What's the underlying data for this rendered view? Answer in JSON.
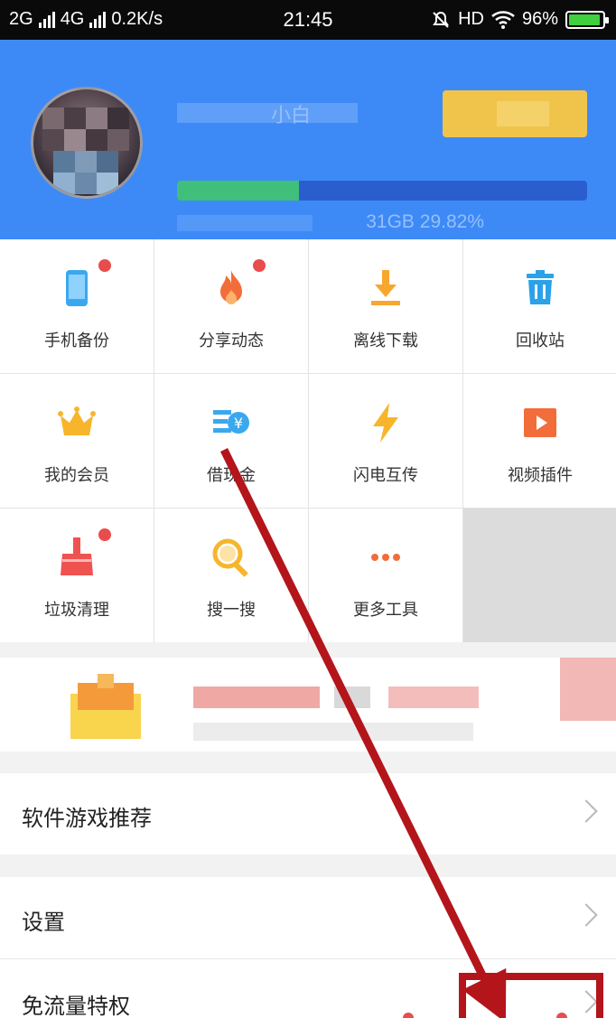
{
  "status_bar": {
    "network_1": "2G",
    "network_2": "4G",
    "speed": "0.2K/s",
    "time": "21:45",
    "hd": "HD",
    "battery": "96%"
  },
  "profile": {
    "username_partial": "小白",
    "storage_text": "31GB 29.82%",
    "storage_used_fraction": 0.2982
  },
  "tools": [
    {
      "label": "手机备份",
      "icon": "phone-backup-icon",
      "badge": true
    },
    {
      "label": "分享动态",
      "icon": "flame-icon",
      "badge": true
    },
    {
      "label": "离线下载",
      "icon": "download-icon",
      "badge": false
    },
    {
      "label": "回收站",
      "icon": "trash-icon",
      "badge": false
    },
    {
      "label": "我的会员",
      "icon": "crown-icon",
      "badge": false
    },
    {
      "label": "借现金",
      "icon": "cash-loan-icon",
      "badge": false
    },
    {
      "label": "闪电互传",
      "icon": "lightning-icon",
      "badge": false
    },
    {
      "label": "视频插件",
      "icon": "video-icon",
      "badge": false
    },
    {
      "label": "垃圾清理",
      "icon": "broom-icon",
      "badge": true
    },
    {
      "label": "搜一搜",
      "icon": "search-icon",
      "badge": false
    },
    {
      "label": "更多工具",
      "icon": "more-icon",
      "badge": false
    }
  ],
  "menu": {
    "software_games": "软件游戏推荐",
    "settings": "设置",
    "free_data": "免流量特权"
  },
  "colors": {
    "header_blue": "#3d8af7",
    "badge_red": "#e84c4c",
    "annotation_red": "#b3151b"
  }
}
